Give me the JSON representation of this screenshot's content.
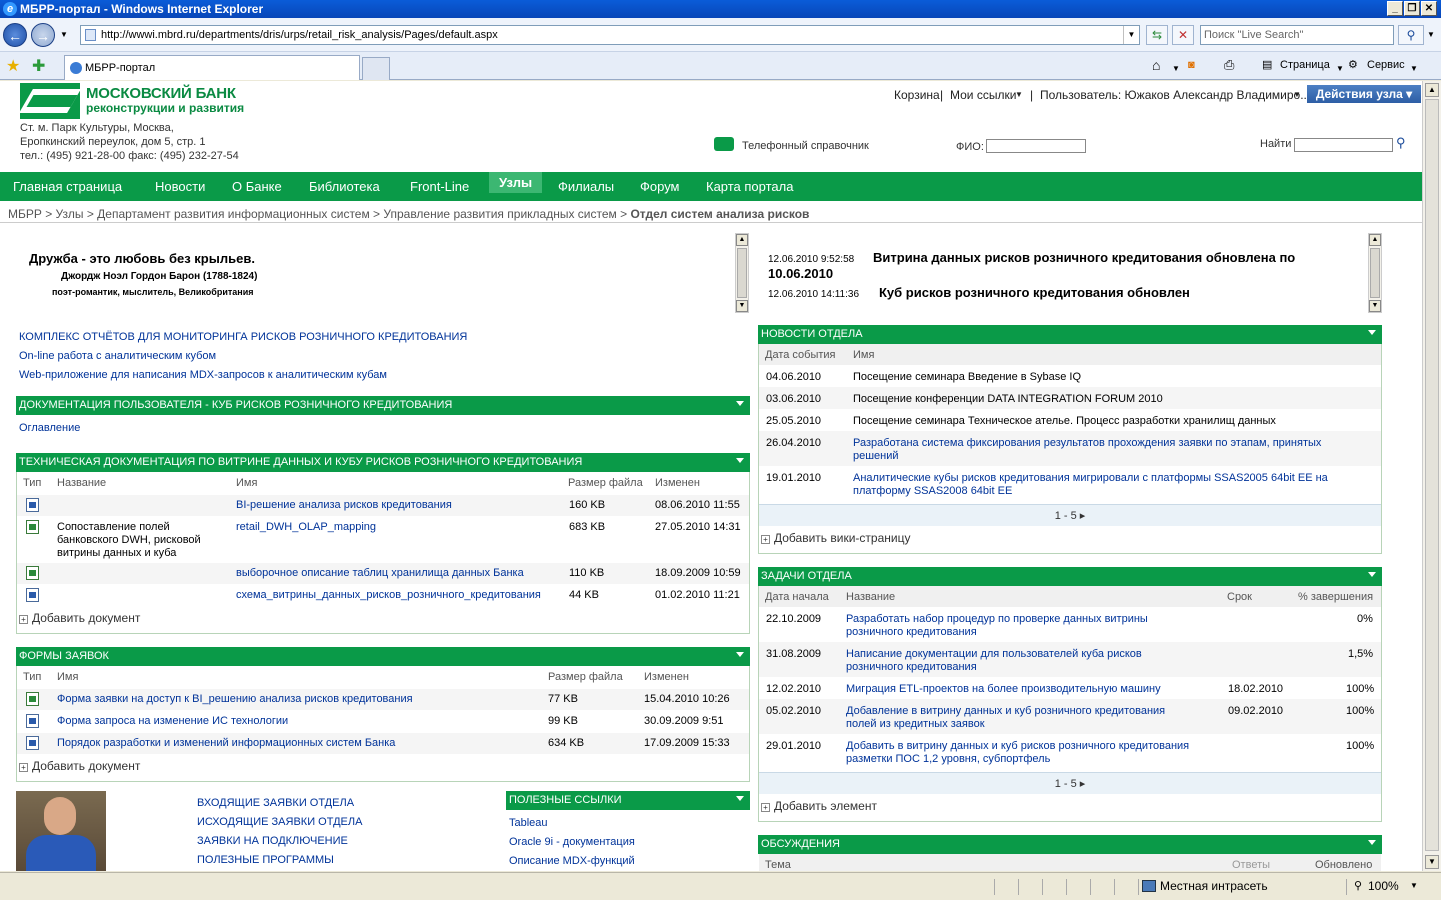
{
  "window": {
    "title": "МБРР-портал - Windows Internet Explorer"
  },
  "browser": {
    "url": "http://wwwi.mbrd.ru/departments/dris/urps/retail_risk_analysis/Pages/default.aspx",
    "search_placeholder": "Поиск \"Live Search\"",
    "tab_title": "МБРР-портал",
    "page_menu": "Страница",
    "tools_menu": "Сервис"
  },
  "header": {
    "bank_name": "МОСКОВСКИЙ БАНК",
    "bank_sub": "реконструкции и развития",
    "address_line1": "Ст. м. Парк Культуры, Москва,",
    "address_line2": "Еропкинский переулок, дом 5, стр. 1",
    "address_line3": "тел.: (495) 921-28-00  факс: (495) 232-27-54",
    "cart": "Корзина",
    "my_links": "Мои ссылки",
    "user": "Пользователь: Южаков Александр Владимиро...",
    "site_actions": "Действия узла",
    "phonebook": "Телефонный справочник",
    "fio_label": "ФИО:",
    "find_label": "Найти"
  },
  "nav": {
    "items": [
      "Главная страница",
      "Новости",
      "О Банке",
      "Библиотека",
      "Front-Line",
      "Узлы",
      "Филиалы",
      "Форум",
      "Карта портала"
    ]
  },
  "breadcrumb": {
    "path": "МБРР > Узлы > Департамент развития информационных систем > Управление развития прикладных систем > ",
    "current": "Отдел систем анализа рисков"
  },
  "quote": {
    "text": "Дружба - это любовь без крыльев.",
    "author": "Джордж Ноэл Гордон Барон (1788-1824)",
    "desc": "поэт-романтик, мыслитель, Великобритания"
  },
  "announcements": [
    {
      "time": "12.06.2010 9:52:58",
      "title": "Витрина данных рисков розничного кредитования обновлена по",
      "title2": "10.06.2010"
    },
    {
      "time": "12.06.2010 14:11:36",
      "title": "Куб рисков розничного кредитования обновлен"
    }
  ],
  "links": [
    "КОМПЛЕКС ОТЧЁТОВ ДЛЯ МОНИТОРИНГА РИСКОВ РОЗНИЧНОГО КРЕДИТОВАНИЯ",
    "On-line работа с аналитическим кубом",
    "Web-приложение для написания MDX-запросов к аналитическим кубам"
  ],
  "user_docs": {
    "title": "ДОКУМЕНТАЦИЯ ПОЛЬЗОВАТЕЛЯ - КУБ РИСКОВ РОЗНИЧНОГО КРЕДИТОВАНИЯ",
    "item": "Оглавление"
  },
  "tech_docs": {
    "title": "ТЕХНИЧЕСКАЯ ДОКУМЕНТАЦИЯ ПО ВИТРИНЕ ДАННЫХ И КУБУ РИСКОВ РОЗНИЧНОГО КРЕДИТОВАНИЯ",
    "cols": [
      "Тип",
      "Название",
      "Имя",
      "Размер файла",
      "Изменен"
    ],
    "rows": [
      {
        "title": "",
        "name": "BI-решение анализа рисков кредитования",
        "size": "160 KB",
        "modified": "08.06.2010 11:55"
      },
      {
        "title": "Сопоставление полей банковского DWH, рисковой витрины данных и куба",
        "name": "retail_DWH_OLAP_mapping",
        "size": "683 KB",
        "modified": "27.05.2010 14:31"
      },
      {
        "title": "",
        "name": "выборочное описание таблиц хранилища данных Банка",
        "size": "110 KB",
        "modified": "18.09.2009 10:59"
      },
      {
        "title": "",
        "name": "схема_витрины_данных_рисков_розничного_кредитования",
        "size": "44 KB",
        "modified": "01.02.2010 11:21"
      }
    ],
    "add": "Добавить документ"
  },
  "forms": {
    "title": "ФОРМЫ ЗАЯВОК",
    "cols": [
      "Тип",
      "Имя",
      "Размер файла",
      "Изменен"
    ],
    "rows": [
      {
        "name": "Форма заявки на доступ к BI_решению анализа рисков кредитования",
        "size": "77 KB",
        "modified": "15.04.2010 10:26"
      },
      {
        "name": "Форма запроса на изменение ИС технологии",
        "size": "99 KB",
        "modified": "30.09.2009 9:51"
      },
      {
        "name": "Порядок разработки и изменений информационных систем Банка",
        "size": "634 KB",
        "modified": "17.09.2009 15:33"
      }
    ],
    "add": "Добавить документ"
  },
  "requests": [
    "ВХОДЯЩИЕ ЗАЯВКИ ОТДЕЛА",
    "ИСХОДЯЩИЕ ЗАЯВКИ ОТДЕЛА",
    "ЗАЯВКИ НА ПОДКЛЮЧЕНИЕ",
    "ПОЛЕЗНЫЕ ПРОГРАММЫ"
  ],
  "useful_links": {
    "title": "ПОЛЕЗНЫЕ ССЫЛКИ",
    "items": [
      "Tableau",
      "Oracle 9i - документация",
      "Описание MDX-функций"
    ]
  },
  "news": {
    "title": "НОВОСТИ ОТДЕЛА",
    "cols": [
      "Дата события",
      "Имя"
    ],
    "rows": [
      {
        "date": "04.06.2010",
        "name": "Посещение семинара Введение в Sybase IQ",
        "name2": ""
      },
      {
        "date": "03.06.2010",
        "name": "Посещение конференции DATA INTEGRATION FORUM 2010",
        "name2": ""
      },
      {
        "date": "25.05.2010",
        "name": "Посещение семинара Техническое ателье. Процесс разработки хранилищ данных",
        "name2": ""
      },
      {
        "date": "26.04.2010",
        "name": "Разработана система фиксирования результатов прохождения заявки по этапам, принятых",
        "name2": "решений"
      },
      {
        "date": "19.01.2010",
        "name": "Аналитические кубы рисков кредитования мигрировали с платформы SSAS2005 64bit EE на",
        "name2": "платформу SSAS2008 64bit EE"
      }
    ],
    "pager": "1 - 5",
    "add": "Добавить вики-страницу"
  },
  "tasks": {
    "title": "ЗАДАЧИ ОТДЕЛА",
    "cols": [
      "Дата начала",
      "Название",
      "Срок",
      "% завершения"
    ],
    "rows": [
      {
        "start": "22.10.2009",
        "name": "Разработать набор процедур по проверке данных витрины",
        "name2": "розничного кредитования",
        "due": "",
        "pct": "0%"
      },
      {
        "start": "31.08.2009",
        "name": "Написание документации для пользователей куба рисков",
        "name2": "розничного кредитования",
        "due": "",
        "pct": "1,5%"
      },
      {
        "start": "12.02.2010",
        "name": "Миграция ETL-проектов на более производительную машину",
        "name2": "",
        "due": "18.02.2010",
        "pct": "100%"
      },
      {
        "start": "05.02.2010",
        "name": "Добавление в витрину данных и куб розничного кредитования",
        "name2": "полей из кредитных заявок",
        "due": "09.02.2010",
        "pct": "100%"
      },
      {
        "start": "29.01.2010",
        "name": "Добавить в витрину данных и куб рисков розничного кредитования",
        "name2": "разметки ПОС 1,2 уровня, субпортфель",
        "due": "",
        "pct": "100%"
      }
    ],
    "pager": "1 - 5",
    "add": "Добавить элемент"
  },
  "discussions": {
    "title": "ОБСУЖДЕНИЯ",
    "cols": [
      "Тема",
      "Ответы",
      "Обновлено"
    ]
  },
  "status": {
    "zone": "Местная интрасеть",
    "zoom": "100%"
  },
  "colors": {
    "green": "#0a9a48",
    "link": "#003399",
    "ie_blue": "#0a5cd8"
  }
}
